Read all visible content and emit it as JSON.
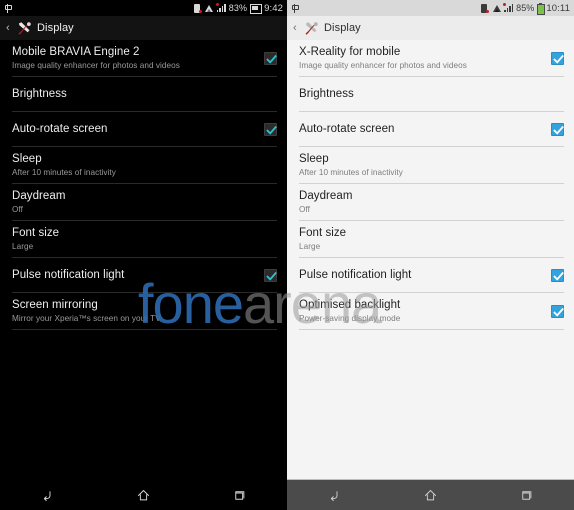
{
  "watermark": {
    "part1": "fone",
    "part2": "arena",
    "color1": "#2e6db4",
    "color2": "#9a9a9a"
  },
  "panels": [
    {
      "theme": "dark",
      "status_bar": {
        "left_icons": [
          "usb-icon"
        ],
        "right_icons": [
          "sim-card-icon",
          "wifi-icon",
          "signal-bars-icon",
          "battery-icon"
        ],
        "battery_percent": "83%",
        "clock": "9:42"
      },
      "action_bar": {
        "back_glyph": "‹",
        "app_icon": "settings-wrench-icon",
        "title": "Display"
      },
      "rows": [
        {
          "title": "Mobile BRAVIA Engine 2",
          "sub": "Image quality enhancer for photos and videos",
          "checkbox": true,
          "checked": true
        },
        {
          "title": "Brightness",
          "sub": "",
          "checkbox": false,
          "checked": false
        },
        {
          "title": "Auto-rotate screen",
          "sub": "",
          "checkbox": true,
          "checked": true
        },
        {
          "title": "Sleep",
          "sub": "After 10 minutes of inactivity",
          "checkbox": false,
          "checked": false
        },
        {
          "title": "Daydream",
          "sub": "Off",
          "checkbox": false,
          "checked": false
        },
        {
          "title": "Font size",
          "sub": "Large",
          "checkbox": false,
          "checked": false
        },
        {
          "title": "Pulse notification light",
          "sub": "",
          "checkbox": true,
          "checked": true
        },
        {
          "title": "Screen mirroring",
          "sub": "Mirror your Xperia™s screen on your TV",
          "checkbox": false,
          "checked": false
        }
      ],
      "nav_bar": [
        "back-nav-icon",
        "home-nav-icon",
        "recent-apps-nav-icon"
      ]
    },
    {
      "theme": "light",
      "status_bar": {
        "left_icons": [
          "usb-icon"
        ],
        "right_icons": [
          "sim-card-icon",
          "wifi-icon",
          "signal-bars-icon",
          "battery-icon"
        ],
        "battery_percent": "85%",
        "clock": "10:11"
      },
      "action_bar": {
        "back_glyph": "‹",
        "app_icon": "settings-wrench-icon",
        "title": "Display"
      },
      "rows": [
        {
          "title": "X-Reality for mobile",
          "sub": "Image quality enhancer for photos and videos",
          "checkbox": true,
          "checked": true
        },
        {
          "title": "Brightness",
          "sub": "",
          "checkbox": false,
          "checked": false
        },
        {
          "title": "Auto-rotate screen",
          "sub": "",
          "checkbox": true,
          "checked": true
        },
        {
          "title": "Sleep",
          "sub": "After 10 minutes of inactivity",
          "checkbox": false,
          "checked": false
        },
        {
          "title": "Daydream",
          "sub": "Off",
          "checkbox": false,
          "checked": false
        },
        {
          "title": "Font size",
          "sub": "Large",
          "checkbox": false,
          "checked": false
        },
        {
          "title": "Pulse notification light",
          "sub": "",
          "checkbox": true,
          "checked": true
        },
        {
          "title": "Optimised backlight",
          "sub": "Power-saving display mode",
          "checkbox": true,
          "checked": true
        }
      ],
      "nav_bar": [
        "back-nav-icon",
        "home-nav-icon",
        "recent-apps-nav-icon"
      ]
    }
  ]
}
